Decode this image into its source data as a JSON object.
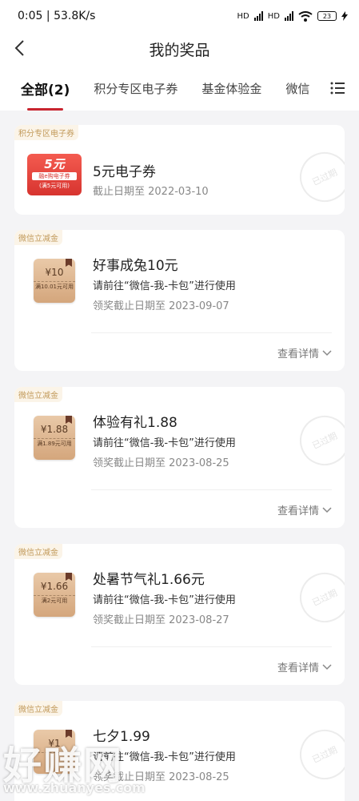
{
  "status_bar": {
    "time": "0:05",
    "speed": "53.8K/s",
    "hd1": "HD",
    "hd2": "HD",
    "battery": "23"
  },
  "header": {
    "title": "我的奖品"
  },
  "tabs": [
    {
      "label": "全部(2)"
    },
    {
      "label": "积分专区电子券"
    },
    {
      "label": "基金体验金"
    },
    {
      "label": "微信"
    }
  ],
  "cards": [
    {
      "tag": "积分专区电子券",
      "thumb": {
        "big": "5元",
        "sub": "融e购电子券",
        "cond": "(满5元可用)"
      },
      "title": "5元电子券",
      "lines": [
        "截止日期至 2022-03-10"
      ],
      "stamp": "已过期"
    },
    {
      "tag": "微信立减金",
      "thumb": {
        "amount": "¥10",
        "cond": "满10.01元可用"
      },
      "title": "好事成兔10元",
      "lines": [
        "请前往“微信-我-卡包”进行使用",
        "领奖截止日期至 2023-09-07"
      ],
      "detail": "查看详情"
    },
    {
      "tag": "微信立减金",
      "thumb": {
        "amount": "¥1.88",
        "cond": "满1.89元可用"
      },
      "title": "体验有礼1.88",
      "lines": [
        "请前往“微信-我-卡包”进行使用",
        "领奖截止日期至 2023-08-25"
      ],
      "detail": "查看详情",
      "stamp": "已过期"
    },
    {
      "tag": "微信立减金",
      "thumb": {
        "amount": "¥1.66",
        "cond": "满2元可用"
      },
      "title": "处暑节气礼1.66元",
      "lines": [
        "请前往“微信-我-卡包”进行使用",
        "领奖截止日期至 2023-08-27"
      ],
      "detail": "查看详情",
      "stamp": "已过期"
    },
    {
      "tag": "微信立减金",
      "thumb": {
        "amount": "¥1",
        "cond": ""
      },
      "title": "七夕1.99",
      "lines": [
        "请前往“微信-我-卡包”进行使用",
        "领奖截止日期至 2023-08-25"
      ],
      "stamp": "已过期"
    }
  ],
  "watermark": {
    "site": "好赚网",
    "url": "www.zhuanyes.com"
  }
}
